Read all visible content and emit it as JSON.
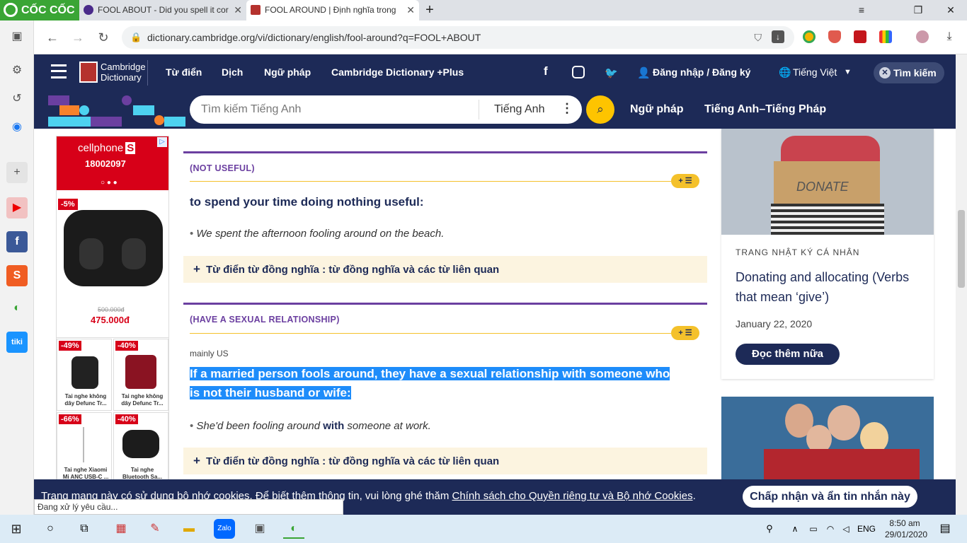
{
  "browser": {
    "brand": "CỐC CỐC",
    "tabs": [
      {
        "title": "FOOL ABOUT - Did you spell it cor"
      },
      {
        "title": "FOOL AROUND | Định nghĩa trong"
      }
    ],
    "url": "dictionary.cambridge.org/vi/dictionary/english/fool-around?q=FOOL+ABOUT",
    "status": "Đang xử lý yêu cầu..."
  },
  "site": {
    "logo_line1": "Cambridge",
    "logo_line2": "Dictionary",
    "nav": [
      "Từ điển",
      "Dịch",
      "Ngữ pháp",
      "Cambridge Dictionary +Plus"
    ],
    "login": "Đăng nhập / Đăng ký",
    "language": "Tiếng Việt",
    "search_toggle": "Tìm kiếm",
    "search_placeholder": "Tìm kiếm Tiếng Anh",
    "search_lang": "Tiếng Anh",
    "links": [
      "Ngữ pháp",
      "Tiếng Anh–Tiếng Pháp"
    ]
  },
  "ad": {
    "brand": "cellphone",
    "brand_s": "S",
    "phone": "18002097",
    "main": {
      "badge": "-5%",
      "old_price": "500.000đ",
      "price": "475.000đ"
    },
    "products": [
      {
        "badge": "-49%",
        "name": "Tai nghe không dây Defunc Tr..."
      },
      {
        "badge": "-40%",
        "name": "Tai nghe không dây Defunc Tr..."
      },
      {
        "badge": "-66%",
        "name": "Tai nghe Xiaomi Mi ANC USB-C ..."
      },
      {
        "badge": "-40%",
        "name": "Tai nghe Bluetooth Sa..."
      }
    ]
  },
  "entry": {
    "sense1": {
      "label": "(NOT USEFUL)",
      "definition": "to spend your time doing nothing useful:",
      "example": "We spent the afternoon fooling around on the beach.",
      "thesaurus": "Từ điển từ đồng nghĩa : từ đồng nghĩa và các từ liên quan"
    },
    "sense2": {
      "label": "(HAVE A SEXUAL RELATIONSHIP)",
      "region": "mainly US",
      "definition_line1": "If a married person fools around, they have a sexual relationship with someone who",
      "definition_line2": "is not their husband or wife:",
      "example_pre": "She'd been fooling around ",
      "example_bold": "with",
      "example_post": " someone at work.",
      "thesaurus": "Từ điển từ đồng nghĩa : từ đồng nghĩa và các từ liên quan"
    },
    "pill": "+ ☰"
  },
  "blog": {
    "image_label": "DONATE",
    "category": "TRANG NHẬT KÝ CÁ NHÂN",
    "title": "Donating and allocating (Verbs that mean ‘give’)",
    "date": "January 22, 2020",
    "read_more": "Đọc thêm nữa"
  },
  "cookie": {
    "text": "Trang mạng này có sử dụng bộ nhớ cookies. Để biết thêm thông tin, vui lòng ghé thăm ",
    "link": "Chính sách cho Quyền riêng tư và Bộ nhớ Cookies",
    "accept": "Chấp nhận và ẩn tin nhắn này"
  },
  "taskbar": {
    "lang": "ENG",
    "time": "8:50 am",
    "date": "29/01/2020"
  }
}
